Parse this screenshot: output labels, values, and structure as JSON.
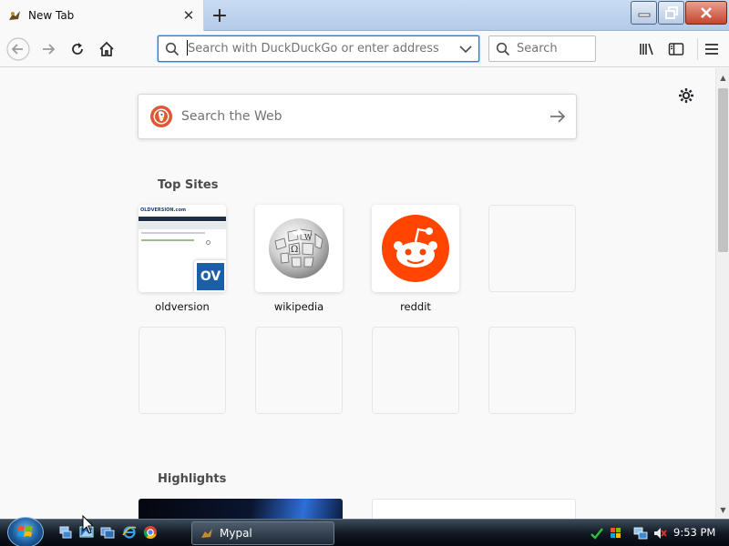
{
  "browser": {
    "tab": {
      "title": "New Tab"
    },
    "url_bar": {
      "placeholder": "Search with DuckDuckGo or enter address",
      "value": ""
    },
    "search_bar": {
      "placeholder": "Search"
    }
  },
  "newtab": {
    "search": {
      "placeholder": "Search the Web"
    },
    "top_sites": {
      "title": "Top Sites",
      "tiles": [
        {
          "label": "oldversion",
          "thumbnail_text": "OLDVERSION.com",
          "badge": "OV"
        },
        {
          "label": "wikipedia",
          "glyph": "Ω"
        },
        {
          "label": "reddit"
        }
      ]
    },
    "highlights": {
      "title": "Highlights"
    }
  },
  "taskbar": {
    "task_label": "Mypal",
    "clock": "9:53 PM"
  },
  "colors": {
    "accent": "#0a84ff",
    "reddit": "#ff4500",
    "duckduckgo": "#de5833",
    "oldversion_badge": "#1d5fa7"
  }
}
